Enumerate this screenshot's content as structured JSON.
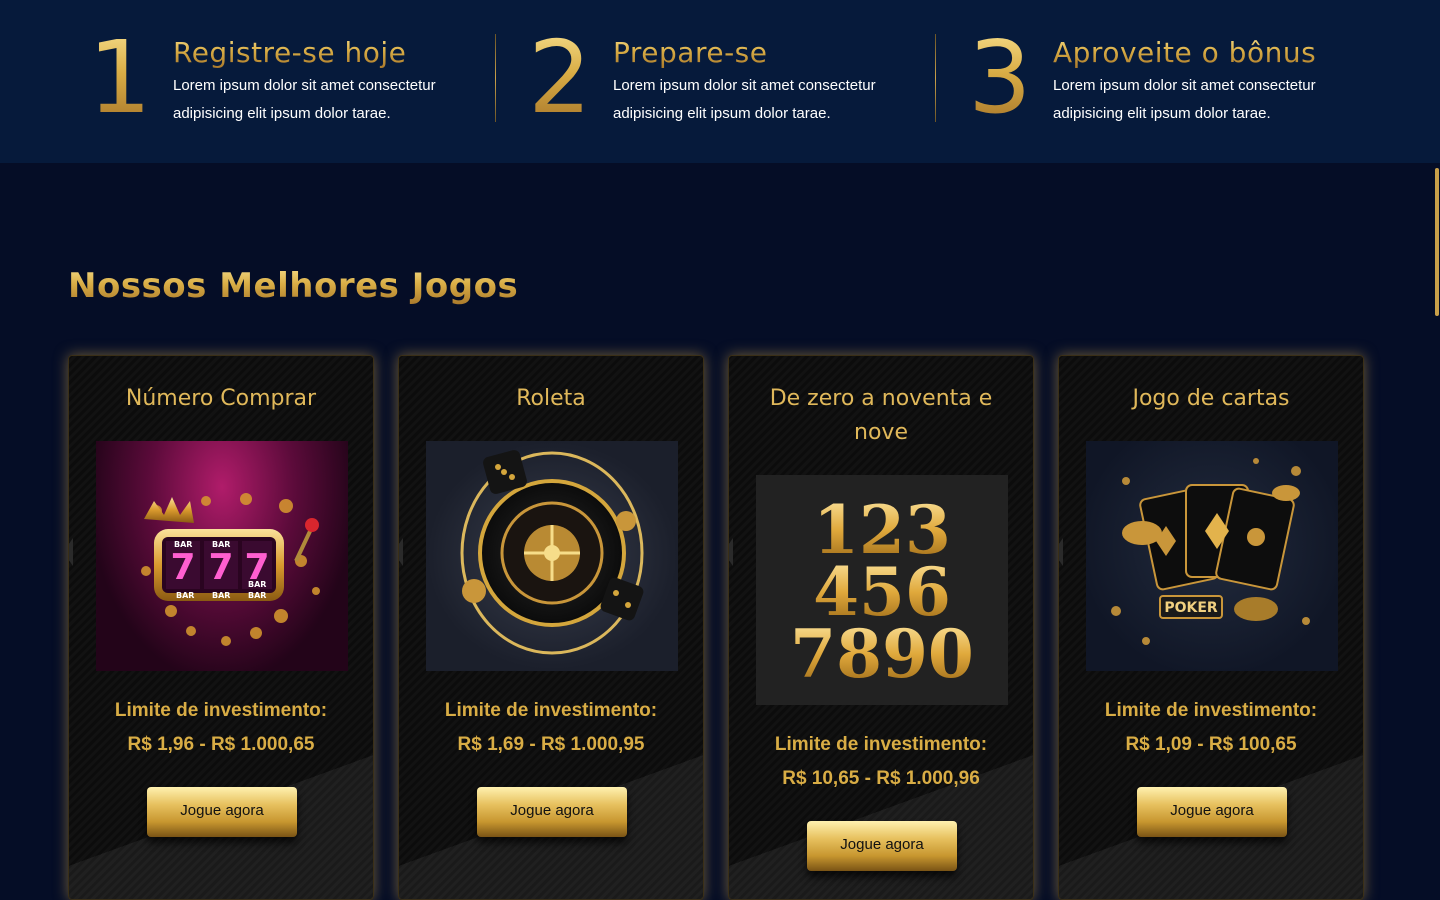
{
  "steps": [
    {
      "number": "1",
      "title": "Registre-se hoje",
      "text": "Lorem ipsum dolor sit amet consectetur adipisicing elit ipsum dolor tarae."
    },
    {
      "number": "2",
      "title": "Prepare-se",
      "text": "Lorem ipsum dolor sit amet consectetur adipisicing elit ipsum dolor tarae."
    },
    {
      "number": "3",
      "title": "Aproveite o bônus",
      "text": "Lorem ipsum dolor sit amet consectetur adipisicing elit ipsum dolor tarae."
    }
  ],
  "games_section": {
    "title": "Nossos Melhores Jogos",
    "cards": [
      {
        "title": "Número Comprar",
        "image": "slot-machine-777-image",
        "limit_label": "Limite de investimento:",
        "range": "R$ 1,96 - R$ 1.000,65",
        "button": "Jogue agora"
      },
      {
        "title": "Roleta",
        "image": "roulette-wheel-image",
        "limit_label": "Limite de investimento:",
        "range": "R$ 1,69 - R$ 1.000,95",
        "button": "Jogue agora"
      },
      {
        "title": "De zero a noventa e nove",
        "image": "gold-numbers-image",
        "image_lines": [
          "123",
          "456",
          "7890"
        ],
        "limit_label": "Limite de investimento:",
        "range": "R$ 10,65 - R$ 1.000,96",
        "button": "Jogue agora"
      },
      {
        "title": "Jogo de cartas",
        "image": "poker-cards-image",
        "image_caption": "POKER",
        "limit_label": "Limite de investimento:",
        "range": "R$ 1,09 - R$ 100,65",
        "button": "Jogue agora"
      }
    ]
  },
  "slot_reels": [
    "7",
    "7",
    "7"
  ],
  "slot_bar_labels": [
    "BAR",
    "BAR",
    "BAR",
    "BAR",
    "BAR",
    "BAR"
  ],
  "colors": {
    "gold": "#d9ad45",
    "band": "#061a3b",
    "page": "#050d26"
  }
}
